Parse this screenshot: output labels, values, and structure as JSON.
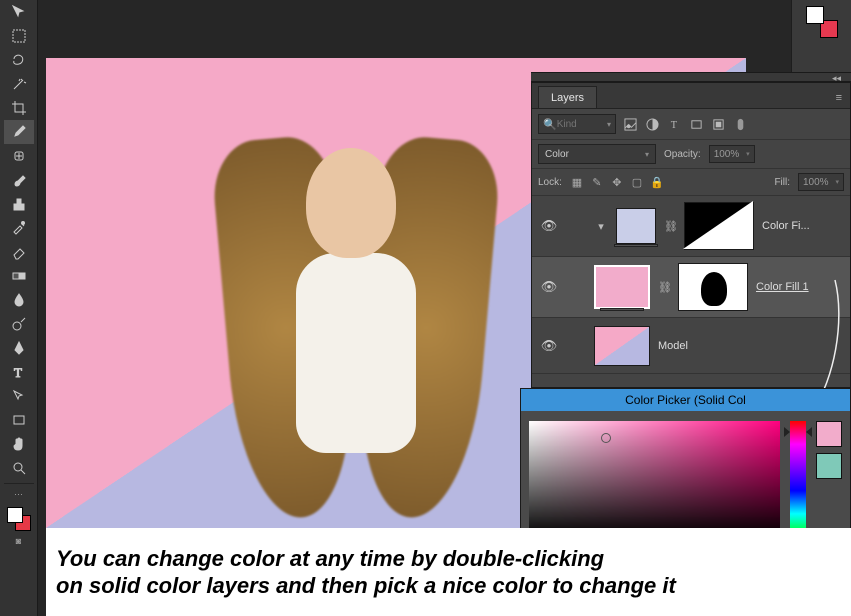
{
  "toolbox": {
    "tools": [
      "move",
      "marquee",
      "lasso",
      "magic-wand",
      "crop",
      "eyedropper",
      "healing",
      "brush",
      "stamp",
      "history-brush",
      "eraser",
      "gradient",
      "blur",
      "dodge",
      "pen",
      "type",
      "path-select",
      "rectangle",
      "hand",
      "zoom"
    ],
    "active_tool": "eyedropper",
    "fg_color": "#ffffff",
    "bg_color": "#e63946"
  },
  "right_swatch": {
    "fg": "#ffffff",
    "bg": "#e53950"
  },
  "collapse_glyph": "◂◂",
  "layers_panel": {
    "tab_label": "Layers",
    "menu_glyph": "≡",
    "kind_placeholder": "Kind",
    "blend_mode": "Color",
    "opacity_label": "Opacity:",
    "opacity_value": "100%",
    "lock_label": "Lock:",
    "fill_label": "Fill:",
    "fill_value": "100%",
    "layers": [
      {
        "name": "Color Fi...",
        "thumb": "fill-blue",
        "mask": "tri",
        "selected": false
      },
      {
        "name": "Color Fill 1",
        "thumb": "fill-pink",
        "mask": "subject",
        "selected": true,
        "underline": true
      },
      {
        "name": "Model",
        "thumb": "img-model",
        "mask": "",
        "selected": false
      }
    ]
  },
  "color_picker": {
    "title": "Color Picker (Solid Col",
    "current": "#f2accb",
    "previous": "#7fc9b8"
  },
  "caption": {
    "line1": "You can change color at any time by double-clicking",
    "line2": "on solid color layers and then pick a nice color to change it"
  }
}
